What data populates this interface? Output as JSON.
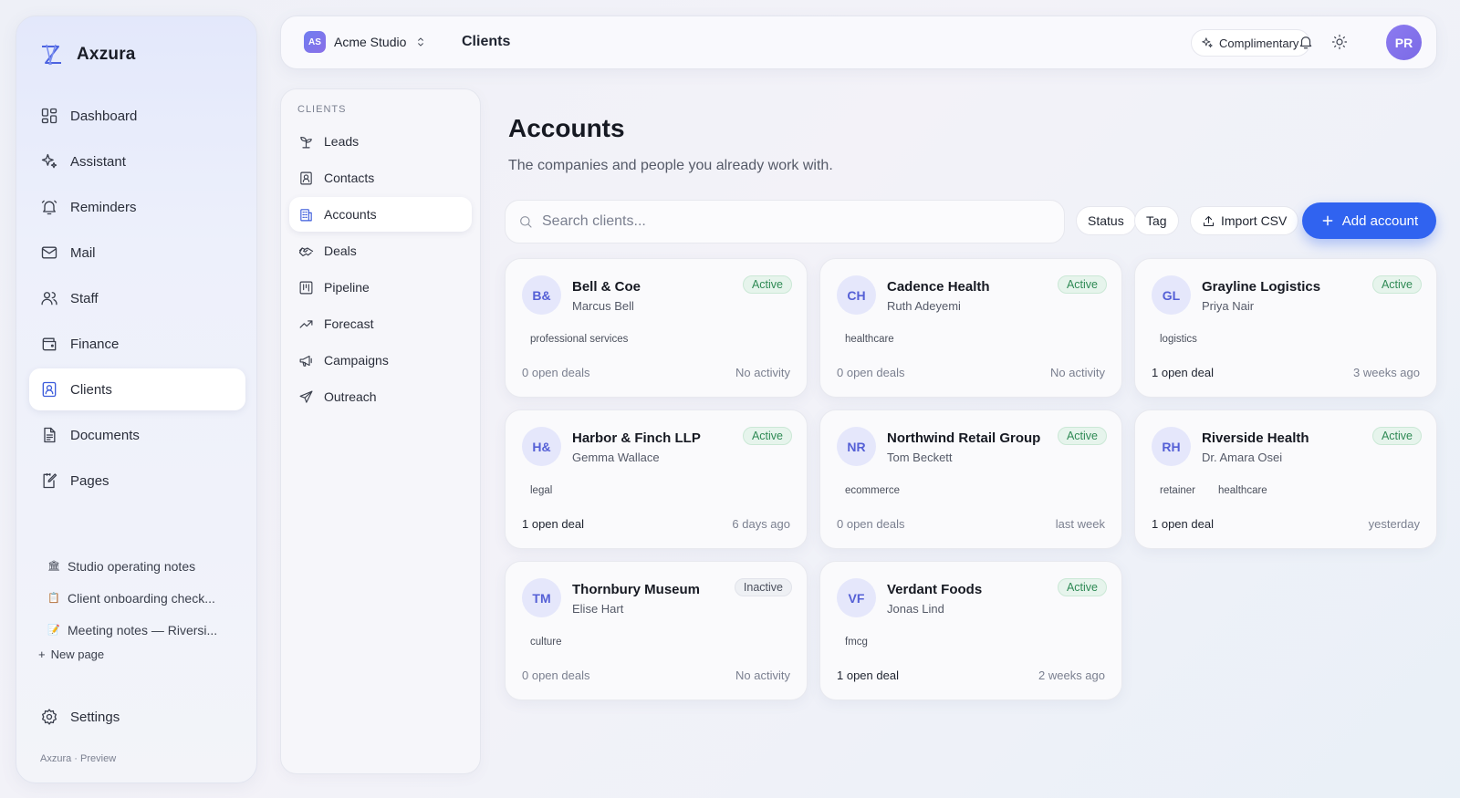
{
  "app": {
    "name": "Axzura",
    "footer": "Axzura · Preview"
  },
  "sidebar": {
    "items": [
      {
        "label": "Dashboard",
        "icon": "dashboard-icon"
      },
      {
        "label": "Assistant",
        "icon": "sparkle-icon"
      },
      {
        "label": "Reminders",
        "icon": "bell-ring-icon"
      },
      {
        "label": "Mail",
        "icon": "mail-icon"
      },
      {
        "label": "Staff",
        "icon": "users-icon"
      },
      {
        "label": "Finance",
        "icon": "wallet-icon"
      },
      {
        "label": "Clients",
        "icon": "contact-card-icon",
        "active": true
      },
      {
        "label": "Documents",
        "icon": "document-icon"
      },
      {
        "label": "Pages",
        "icon": "edit-page-icon"
      }
    ],
    "pages": [
      {
        "emoji": "🏛",
        "label": "Studio operating notes"
      },
      {
        "emoji": "📋",
        "label": "Client onboarding check..."
      },
      {
        "emoji": "📝",
        "label": "Meeting notes — Riversi..."
      }
    ],
    "new_page": "New page",
    "settings": "Settings"
  },
  "topbar": {
    "workspace_initials": "AS",
    "workspace_name": "Acme Studio",
    "breadcrumb": "Clients",
    "plan_label": "Complimentary",
    "user_initials": "PR"
  },
  "subnav": {
    "heading": "CLIENTS",
    "items": [
      {
        "label": "Leads",
        "icon": "sprout-icon"
      },
      {
        "label": "Contacts",
        "icon": "contact-card-icon"
      },
      {
        "label": "Accounts",
        "icon": "building-icon",
        "active": true
      },
      {
        "label": "Deals",
        "icon": "handshake-icon"
      },
      {
        "label": "Pipeline",
        "icon": "kanban-icon"
      },
      {
        "label": "Forecast",
        "icon": "trend-up-icon"
      },
      {
        "label": "Campaigns",
        "icon": "megaphone-icon"
      },
      {
        "label": "Outreach",
        "icon": "send-icon"
      }
    ]
  },
  "main": {
    "title": "Accounts",
    "subtitle": "The companies and people you already work with.",
    "search_placeholder": "Search clients...",
    "filters": {
      "status": "Status",
      "tag": "Tag",
      "import": "Import CSV"
    },
    "add_button": "Add account",
    "accounts": [
      {
        "initials": "B&",
        "name": "Bell & Coe",
        "person": "Marcus Bell",
        "status": "Active",
        "tags": [
          "professional services"
        ],
        "deals": "0 open deals",
        "activity": "No activity"
      },
      {
        "initials": "CH",
        "name": "Cadence Health",
        "person": "Ruth Adeyemi",
        "status": "Active",
        "tags": [
          "healthcare"
        ],
        "deals": "0 open deals",
        "activity": "No activity"
      },
      {
        "initials": "GL",
        "name": "Grayline Logistics",
        "person": "Priya Nair",
        "status": "Active",
        "tags": [
          "logistics"
        ],
        "deals": "1 open deal",
        "activity": "3 weeks ago"
      },
      {
        "initials": "H&",
        "name": "Harbor & Finch LLP",
        "person": "Gemma Wallace",
        "status": "Active",
        "tags": [
          "legal"
        ],
        "deals": "1 open deal",
        "activity": "6 days ago"
      },
      {
        "initials": "NR",
        "name": "Northwind Retail Group",
        "person": "Tom Beckett",
        "status": "Active",
        "tags": [
          "ecommerce"
        ],
        "deals": "0 open deals",
        "activity": "last week"
      },
      {
        "initials": "RH",
        "name": "Riverside Health",
        "person": "Dr. Amara Osei",
        "status": "Active",
        "tags": [
          "retainer",
          "healthcare"
        ],
        "deals": "1 open deal",
        "activity": "yesterday"
      },
      {
        "initials": "TM",
        "name": "Thornbury Museum",
        "person": "Elise Hart",
        "status": "Inactive",
        "tags": [
          "culture"
        ],
        "deals": "0 open deals",
        "activity": "No activity"
      },
      {
        "initials": "VF",
        "name": "Verdant Foods",
        "person": "Jonas Lind",
        "status": "Active",
        "tags": [
          "fmcg"
        ],
        "deals": "1 open deal",
        "activity": "2 weeks ago"
      }
    ]
  },
  "colors": {
    "accent": "#3063f0",
    "active_badge": "#2f8a55",
    "avatar_text": "#5560d6"
  }
}
